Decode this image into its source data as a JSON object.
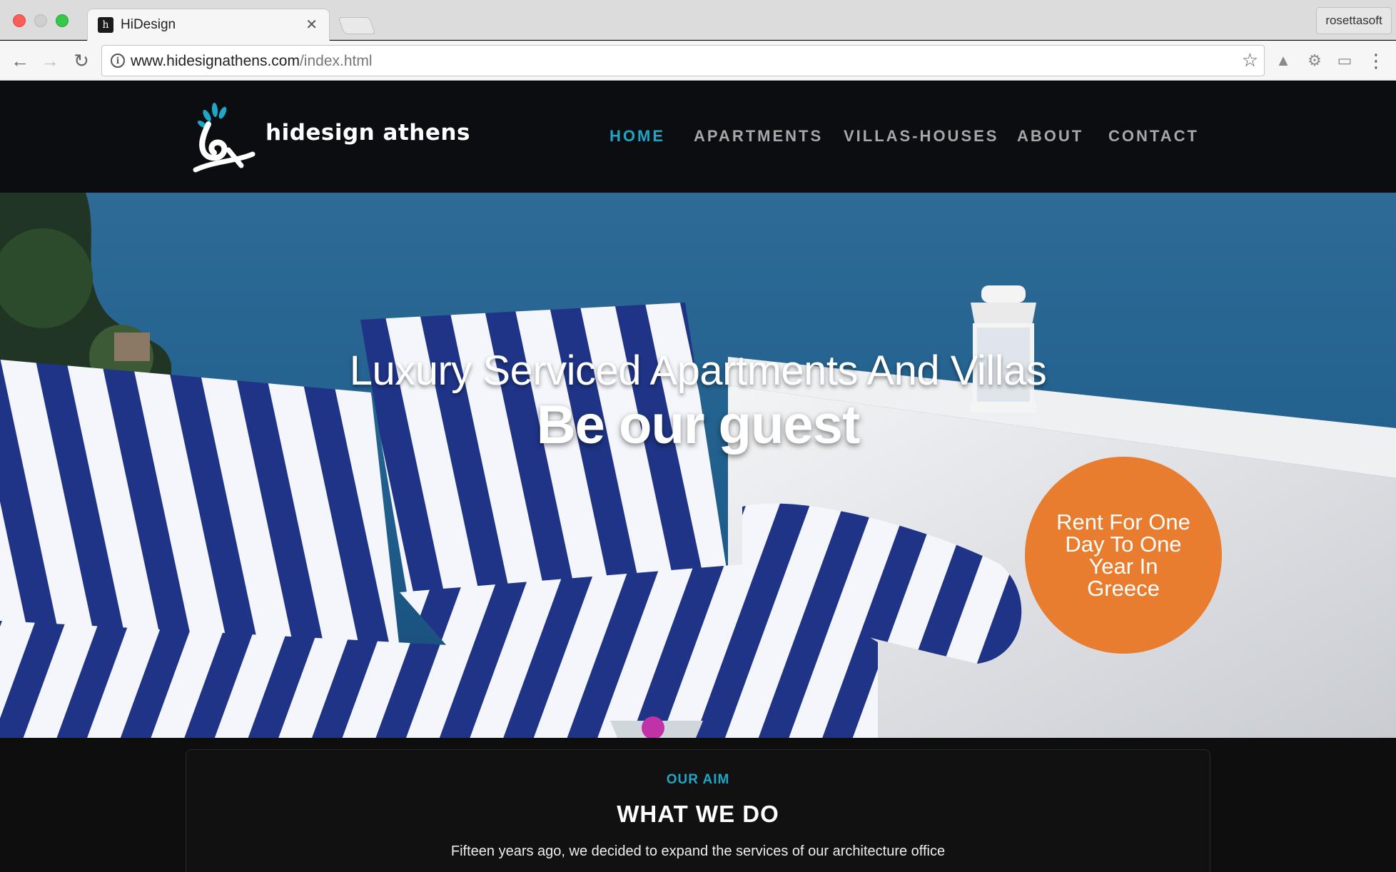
{
  "browser": {
    "tab_title": "HiDesign",
    "url_domain": "www.hidesignathens.com",
    "url_path": "/index.html",
    "profile_name": "rosettasoft"
  },
  "site": {
    "logo_text": "hidesign athens",
    "nav": [
      {
        "label": "HOME",
        "active": true
      },
      {
        "label": "APARTMENTS",
        "active": false
      },
      {
        "label": "VILLAS-HOUSES",
        "active": false
      },
      {
        "label": "ABOUT",
        "active": false
      },
      {
        "label": "CONTACT",
        "active": false
      }
    ],
    "hero": {
      "title": "Luxury Serviced Apartments And Villas",
      "subtitle": "Be our guest",
      "badge_text": "Rent For One Day To One Year In Greece"
    },
    "aim": {
      "kicker": "OUR AIM",
      "title": "WHAT WE DO",
      "body": "Fifteen years ago, we decided to expand the services of our architecture office"
    }
  },
  "colors": {
    "accent": "#1fa6c6",
    "badge": "#e97d2f",
    "header_bg": "#0b0d11"
  }
}
